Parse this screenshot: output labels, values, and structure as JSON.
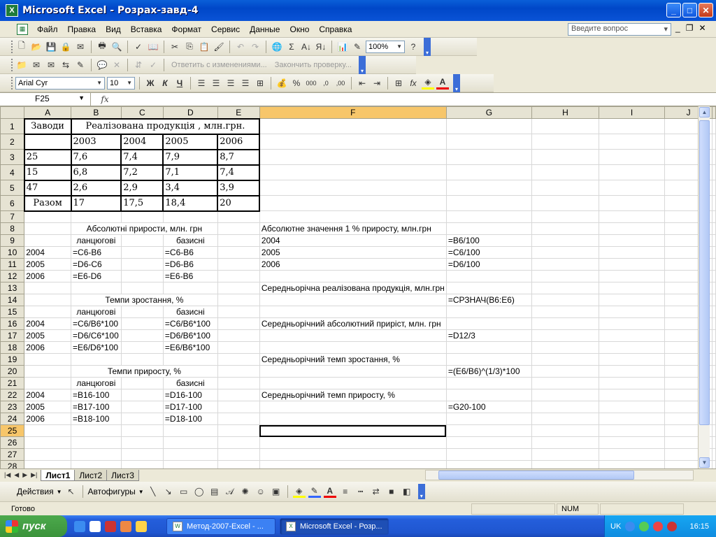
{
  "window": {
    "title": "Microsoft Excel - Розрах-завд-4",
    "app_icon": "X"
  },
  "menu": {
    "items": [
      "Файл",
      "Правка",
      "Вид",
      "Вставка",
      "Формат",
      "Сервис",
      "Данные",
      "Окно",
      "Справка"
    ],
    "question_placeholder": "Введите вопрос"
  },
  "toolbar_standard": {
    "zoom": "100%"
  },
  "toolbar_review": {
    "reply_label": "Ответить с изменениями...",
    "end_review_label": "Закончить проверку..."
  },
  "toolbar_format": {
    "font": "Arial Cyr",
    "size": "10",
    "bold": "Ж",
    "italic": "К",
    "underline": "Ч"
  },
  "formula_bar": {
    "name_box": "F25",
    "formula": ""
  },
  "sheet": {
    "columns": [
      "A",
      "B",
      "C",
      "D",
      "E",
      "F",
      "G",
      "H",
      "I",
      "J"
    ],
    "selected_column": "F",
    "selected_row": "25",
    "selected_cell": "F25",
    "rows": {
      "1": {
        "A": "Заводи",
        "B": "Реалізована продукція , млн.грн."
      },
      "2": {
        "B": "2003",
        "C": "2004",
        "D": "2005",
        "E": "2006"
      },
      "3": {
        "A": "25",
        "B": "7,6",
        "C": "7,4",
        "D": "7,9",
        "E": "8,7"
      },
      "4": {
        "A": "15",
        "B": "6,8",
        "C": "7,2",
        "D": "7,1",
        "E": "7,4"
      },
      "5": {
        "A": "47",
        "B": "2,6",
        "C": "2,9",
        "D": "3,4",
        "E": "3,9"
      },
      "6": {
        "A": "Разом",
        "B": "17",
        "C": "17,5",
        "D": "18,4",
        "E": "20"
      },
      "8": {
        "B": "Абсолютні прирости, млн. грн",
        "F": "Абсолютне значення 1 % приросту, млн.грн"
      },
      "9": {
        "B": "ланцюгові",
        "D": "базисні",
        "F": "2004",
        "G": "=B6/100"
      },
      "10": {
        "A": "2004",
        "B": "=C6-B6",
        "D": "=C6-B6",
        "F": "2005",
        "G": "=C6/100"
      },
      "11": {
        "A": "2005",
        "B": "=D6-C6",
        "D": "=D6-B6",
        "F": "2006",
        "G": "=D6/100"
      },
      "12": {
        "A": "2006",
        "B": "=E6-D6",
        "D": "=E6-B6"
      },
      "13": {
        "F": "Середньорічна реалізована продукція, млн.грн"
      },
      "14": {
        "B": "Темпи зростання, %",
        "G": "=СРЗНАЧ(B6:E6)"
      },
      "15": {
        "B": "ланцюгові",
        "D": "базисні"
      },
      "16": {
        "A": "2004",
        "B": "=C6/B6*100",
        "D": "=C6/B6*100",
        "F": "Середньорічний абсолютний приріст, млн. грн"
      },
      "17": {
        "A": "2005",
        "B": "=D6/C6*100",
        "D": "=D6/B6*100",
        "G": "=D12/3"
      },
      "18": {
        "A": "2006",
        "B": "=E6/D6*100",
        "D": "=E6/B6*100"
      },
      "19": {
        "F": "Середньорічний темп зростання, %"
      },
      "20": {
        "B": "Темпи приросту, %",
        "G": "=(E6/B6)^(1/3)*100"
      },
      "21": {
        "B": "ланцюгові",
        "D": "базисні"
      },
      "22": {
        "A": "2004",
        "B": "=B16-100",
        "D": "=D16-100",
        "F": "Середньорічний темп приросту, %"
      },
      "23": {
        "A": "2005",
        "B": "=B17-100",
        "D": "=D17-100",
        "G": "=G20-100"
      },
      "24": {
        "A": "2006",
        "B": "=B18-100",
        "D": "=D18-100"
      }
    }
  },
  "sheet_tabs": [
    "Лист1",
    "Лист2",
    "Лист3"
  ],
  "active_tab": "Лист1",
  "drawing_toolbar": {
    "actions_label": "Действия",
    "autoshapes_label": "Автофигуры"
  },
  "status": {
    "ready": "Готово",
    "num": "NUM"
  },
  "taskbar": {
    "start_label": "пуск",
    "tasks": [
      "Метод-2007-Excel - ...",
      "Microsoft Excel - Розр..."
    ],
    "lang": "UK",
    "clock": "16:15"
  },
  "colors": {
    "title_blue": "#0a5fd8",
    "selected_header": "#f7c66a",
    "start_green": "#3b933b"
  }
}
